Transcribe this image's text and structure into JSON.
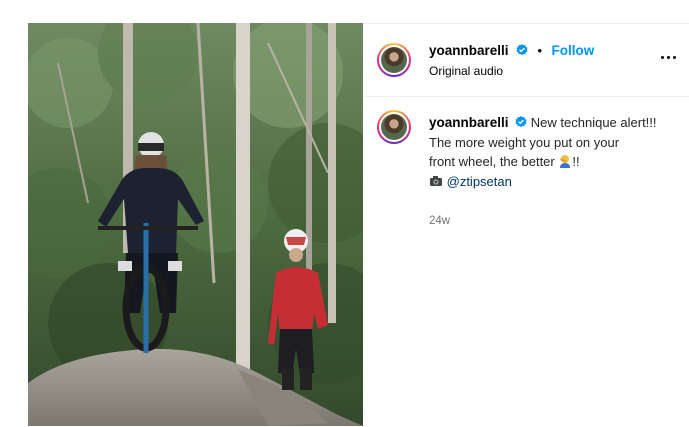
{
  "post": {
    "username": "yoannbarelli",
    "follow_label": "Follow",
    "separator": "•",
    "audio_label": "Original audio",
    "caption_line1": "New technique alert!!!",
    "caption_line2": "The more weight you put on your",
    "caption_line3_text": "front wheel, the better",
    "caption_line3_suffix": "!!",
    "mention": "@ztipsetan",
    "timestamp": "24w"
  },
  "colors": {
    "follow_blue": "#0095f6",
    "verified_blue": "#0095f6",
    "mention_blue": "#00376b",
    "muted_gray": "#737373"
  },
  "icons": {
    "verified": "verified-badge-icon",
    "more": "more-options-icon",
    "face_palm": "person-facepalming-emoji",
    "camera": "camera-emoji"
  }
}
